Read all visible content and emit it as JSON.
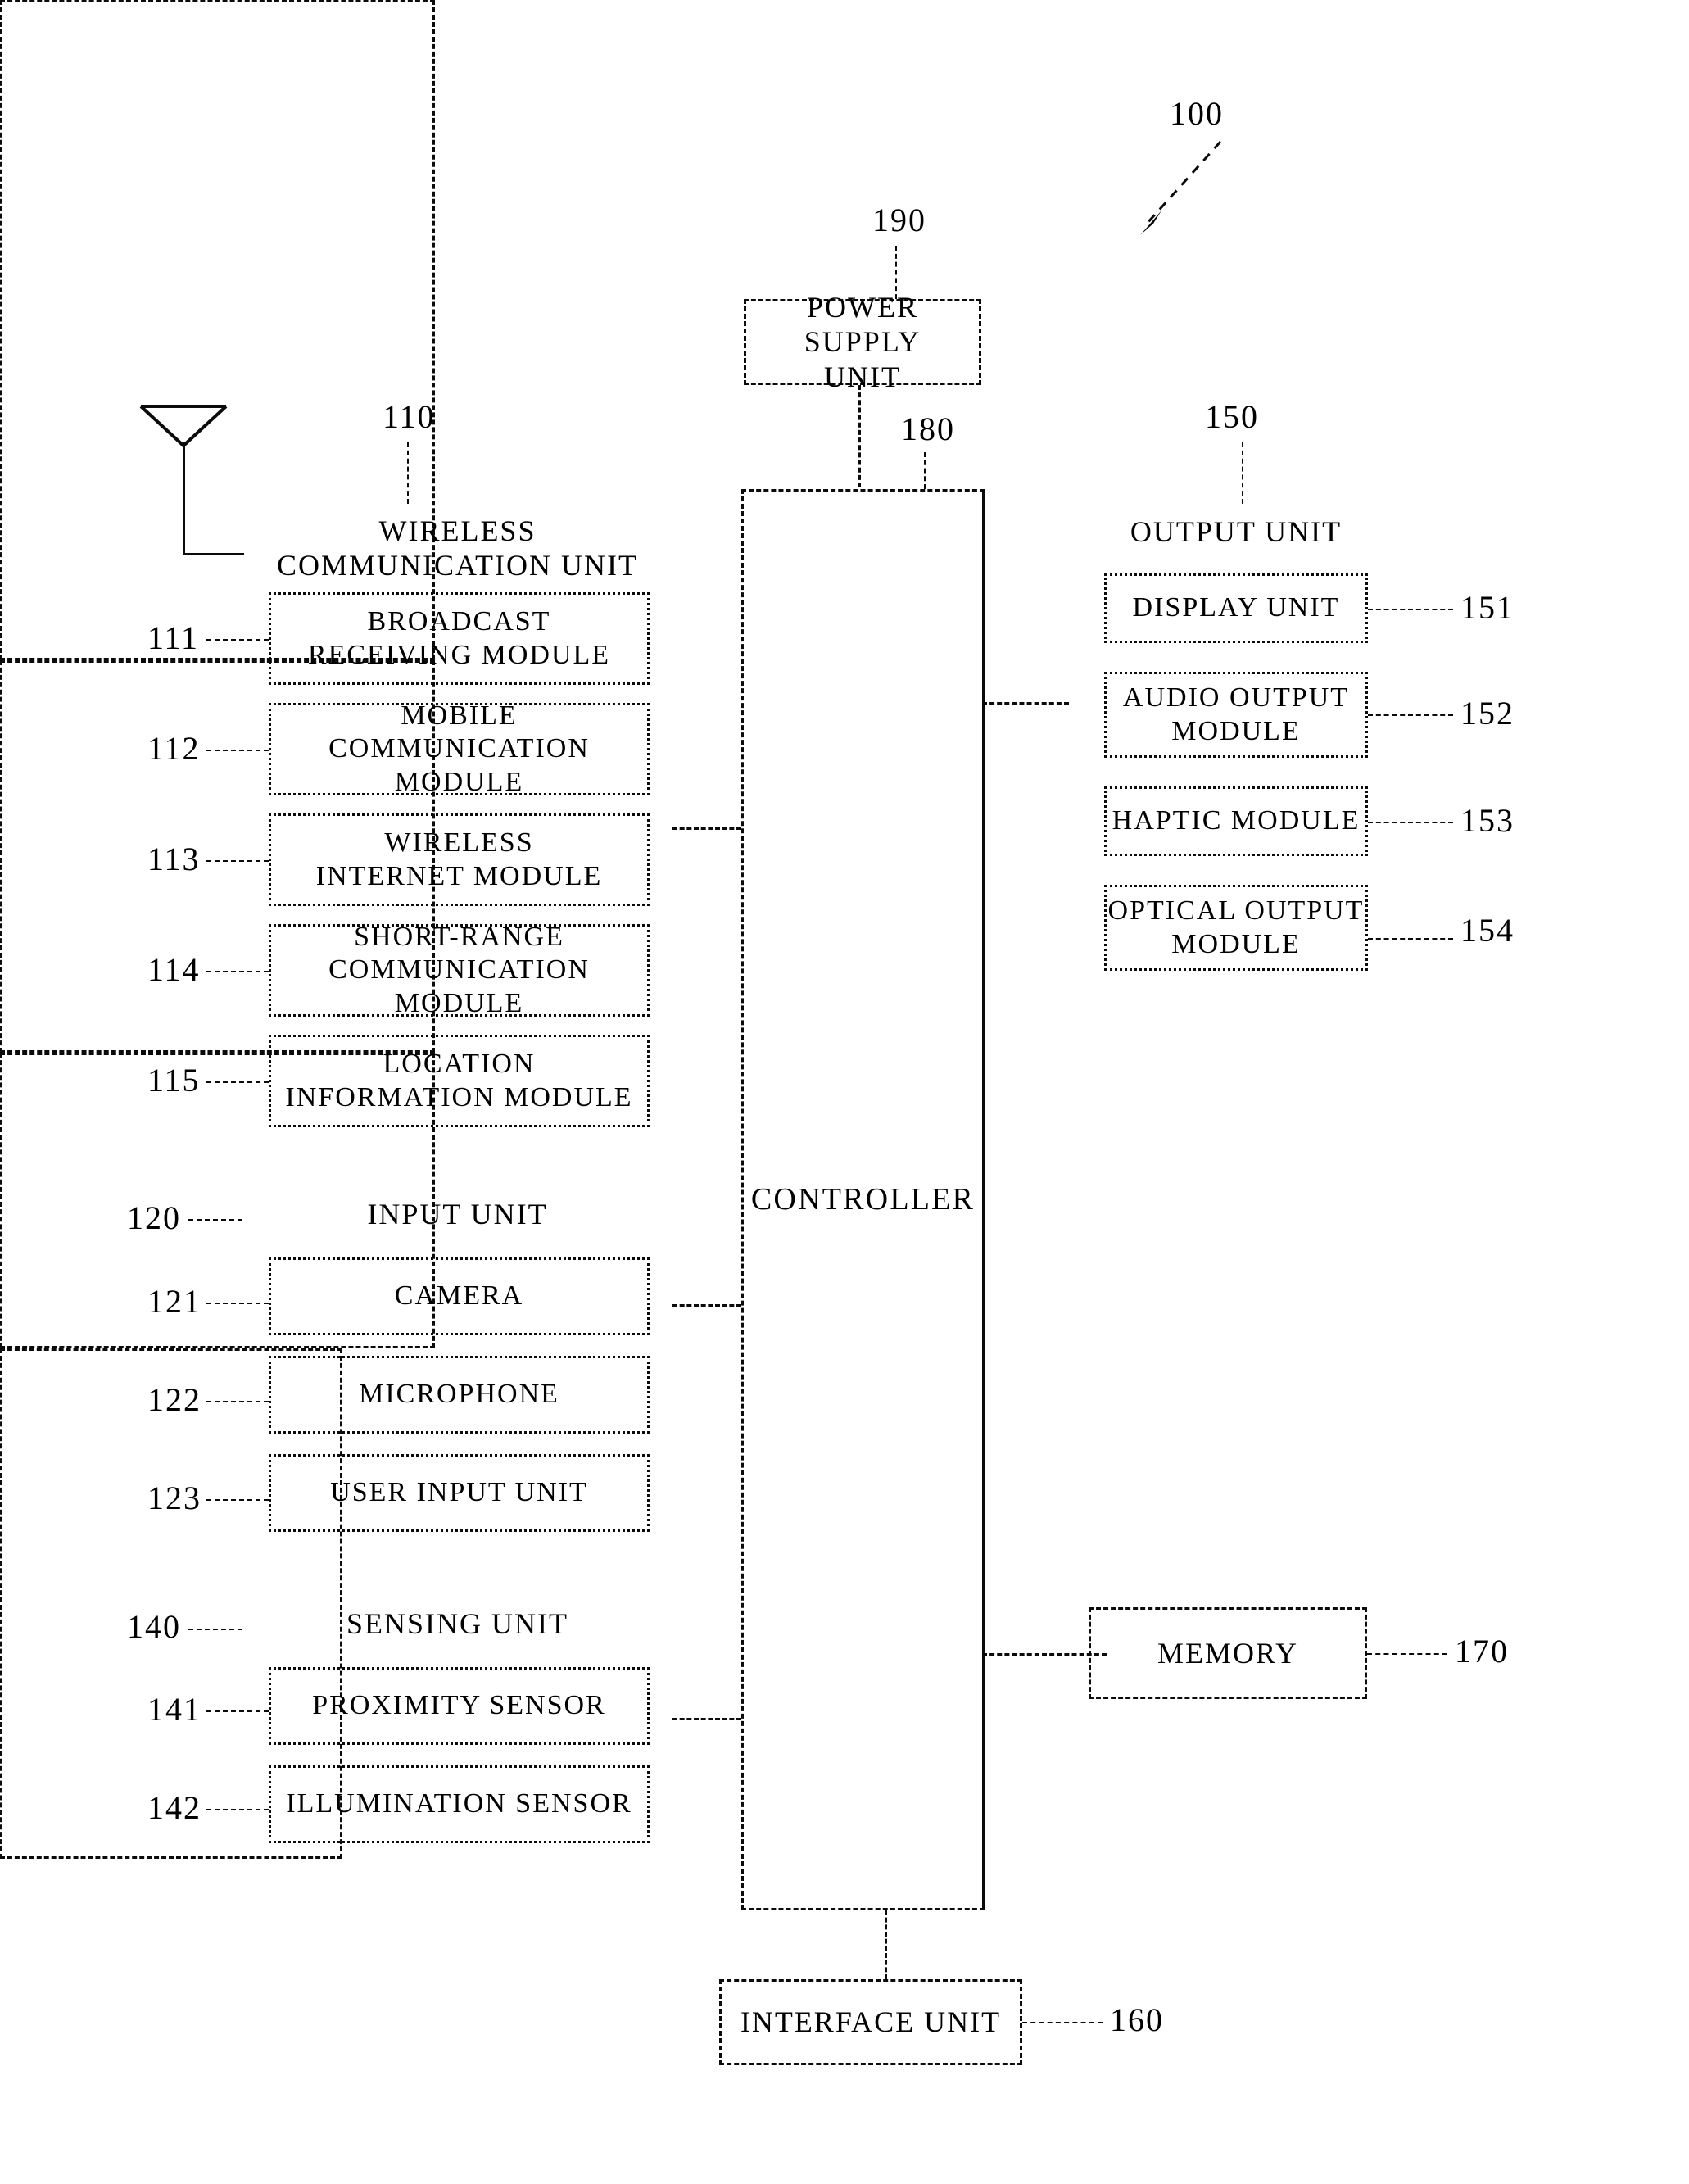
{
  "figure": {
    "type": "patent-block-diagram",
    "overall_ref": "100",
    "background": "#ffffff",
    "line_color": "#0b0b0b"
  },
  "blocks": {
    "power_supply": {
      "label": "POWER SUPPLY\nUNIT",
      "ref": "190"
    },
    "controller": {
      "label": "CONTROLLER",
      "ref": "180"
    },
    "wireless_communication_unit": {
      "label": "WIRELESS\nCOMMUNICATION UNIT",
      "ref": "110"
    },
    "broadcast_receiving_module": {
      "label": "BROADCAST\nRECEIVING MODULE",
      "ref": "111"
    },
    "mobile_communication_module": {
      "label": "MOBILE\nCOMMUNICATION MODULE",
      "ref": "112"
    },
    "wireless_internet_module": {
      "label": "WIRELESS\nINTERNET MODULE",
      "ref": "113"
    },
    "short_range_communication_module": {
      "label": "SHORT-RANGE\nCOMMUNICATION MODULE",
      "ref": "114"
    },
    "location_information_module": {
      "label": "LOCATION\nINFORMATION MODULE",
      "ref": "115"
    },
    "input_unit": {
      "label": "INPUT UNIT",
      "ref": "120"
    },
    "camera": {
      "label": "CAMERA",
      "ref": "121"
    },
    "microphone": {
      "label": "MICROPHONE",
      "ref": "122"
    },
    "user_input_unit": {
      "label": "USER INPUT UNIT",
      "ref": "123"
    },
    "sensing_unit": {
      "label": "SENSING UNIT",
      "ref": "140"
    },
    "proximity_sensor": {
      "label": "PROXIMITY SENSOR",
      "ref": "141"
    },
    "illumination_sensor": {
      "label": "ILLUMINATION SENSOR",
      "ref": "142"
    },
    "output_unit": {
      "label": "OUTPUT UNIT",
      "ref": "150"
    },
    "display_unit": {
      "label": "DISPLAY UNIT",
      "ref": "151"
    },
    "audio_output_module": {
      "label": "AUDIO OUTPUT\nMODULE",
      "ref": "152"
    },
    "haptic_module": {
      "label": "HAPTIC MODULE",
      "ref": "153"
    },
    "optical_output_module": {
      "label": "OPTICAL OUTPUT\nMODULE",
      "ref": "154"
    },
    "memory": {
      "label": "MEMORY",
      "ref": "170"
    },
    "interface_unit": {
      "label": "INTERFACE UNIT",
      "ref": "160"
    }
  }
}
